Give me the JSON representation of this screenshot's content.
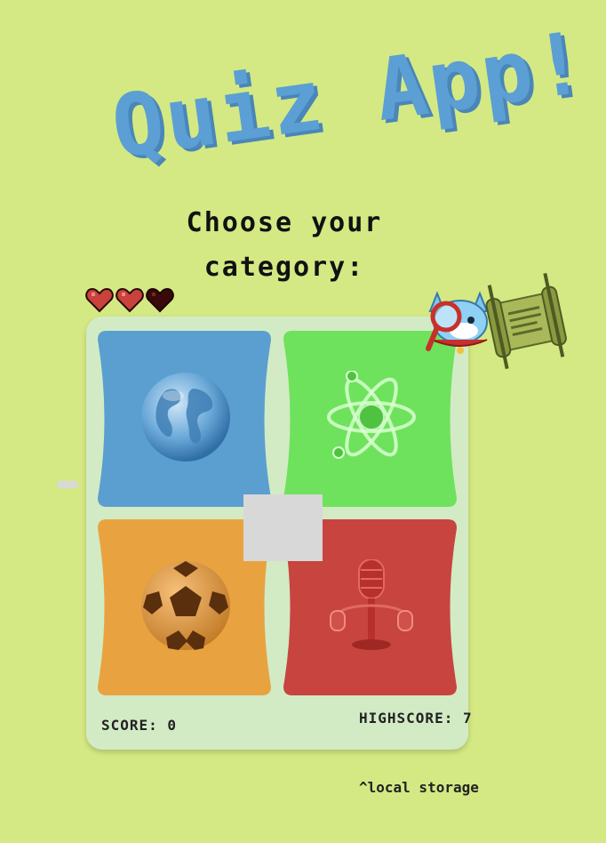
{
  "app": {
    "title": "Quiz App!",
    "prompt_line1": "Choose your",
    "prompt_line2": "category:"
  },
  "lives": {
    "total": 3,
    "remaining": 2,
    "hearts": [
      "full-heart-icon",
      "full-heart-icon",
      "empty-heart-icon"
    ],
    "full_color": "#c9423b",
    "empty_color": "#3a0a0a"
  },
  "categories": [
    {
      "id": "geography",
      "icon": "globe-icon",
      "color": "#5a9fd0"
    },
    {
      "id": "science",
      "icon": "atom-icon",
      "color": "#6ee25c"
    },
    {
      "id": "sports",
      "icon": "soccer-ball-icon",
      "color": "#e8a340"
    },
    {
      "id": "music",
      "icon": "microphone-icon",
      "color": "#c8443f"
    }
  ],
  "scoreboard": {
    "score_label": "SCORE: 0",
    "highscore_label": "HIGHSCORE: 7"
  },
  "footnote": "^local storage",
  "decorations": [
    "detective-cat-icon",
    "scroll-icon"
  ],
  "colors": {
    "background": "#d4e983",
    "title": "#5b9fd4",
    "board": "#d2ebc5"
  }
}
